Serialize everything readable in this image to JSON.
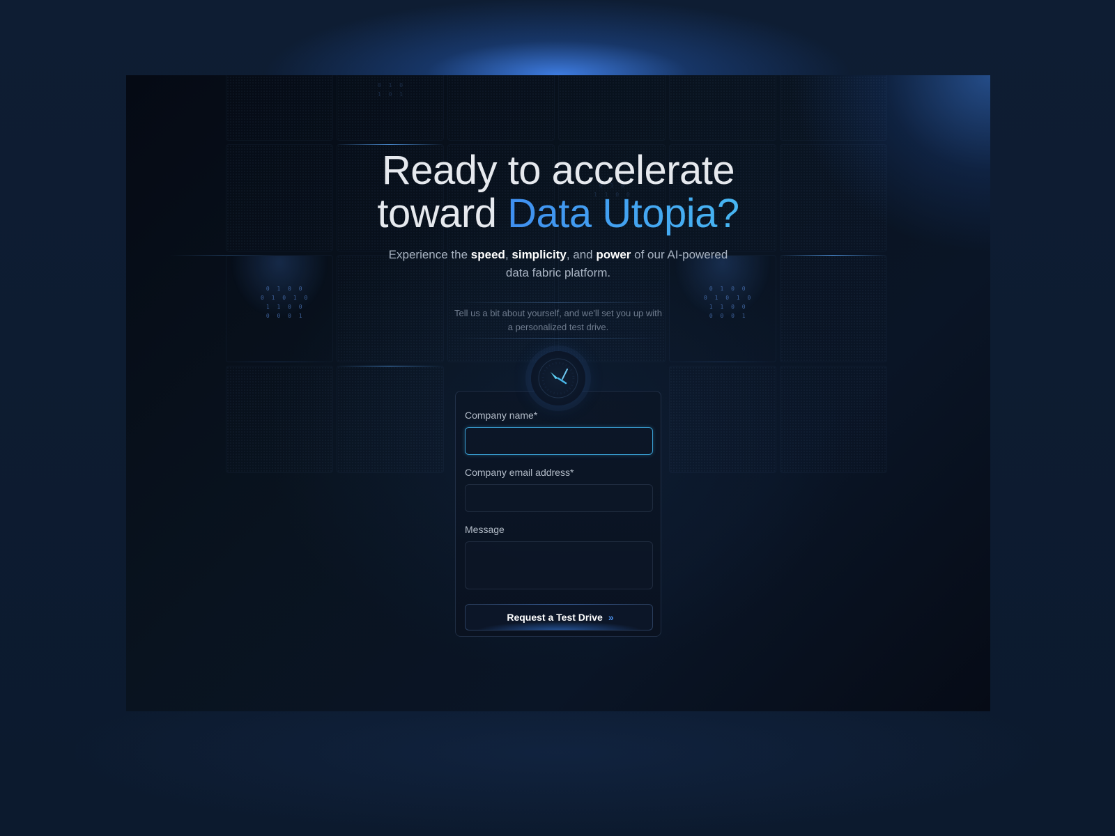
{
  "hero": {
    "headline_line1": "Ready to accelerate",
    "headline_prefix": "toward ",
    "headline_accent": "Data Utopia?",
    "subtitle_part1": "Experience the ",
    "subtitle_bold1": "speed",
    "subtitle_part2": ", ",
    "subtitle_bold2": "simplicity",
    "subtitle_part3": ", and ",
    "subtitle_bold3": "power",
    "subtitle_part4": " of our AI-powered data fabric platform.",
    "intro": "Tell us a bit about yourself, and we'll set you up with a personalized test drive."
  },
  "decor": {
    "binary_left": "0 1 0 0\n0 1 0 1 0\n1 1 0 0\n0 0 0 1",
    "binary_right": "0 1 0 0\n0 1 0 1 0\n1 1 0 0\n0 0 0 1",
    "binary_top": "0 1 0\n1 0 1",
    "binary_center": "0 1 0\n1 1 0 0",
    "gauge_icon": "speedometer-icon",
    "submit_icon": "double-chevron-right-icon"
  },
  "form": {
    "company_name_label": "Company name*",
    "company_name_value": "",
    "email_label": "Company email address*",
    "email_value": "",
    "message_label": "Message",
    "message_value": "",
    "submit_label": "Request a Test Drive",
    "submit_icon_glyph": "»"
  },
  "colors": {
    "accent_gradient_start": "#3f8ff0",
    "accent_gradient_end": "#47b6f2",
    "focus_border": "#3aa3d8",
    "page_background": "#0c1a2e"
  }
}
